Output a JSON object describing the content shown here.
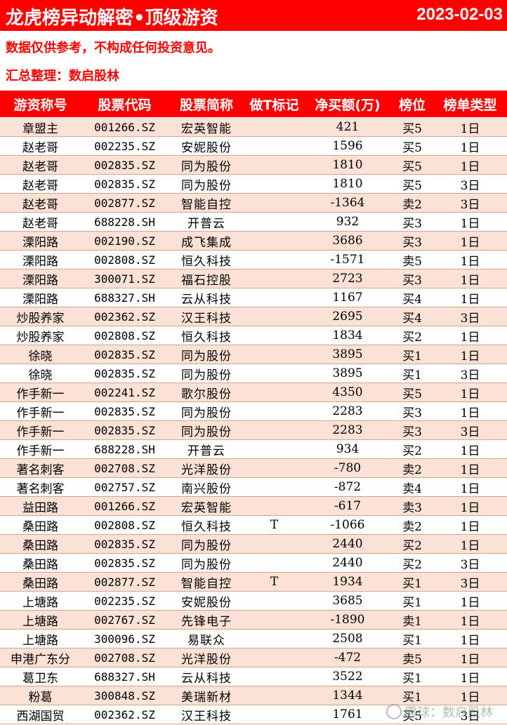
{
  "header": {
    "title": "龙虎榜异动解密•顶级游资",
    "date": "2023-02-03",
    "background_color": "#ff0000"
  },
  "disclaimer": "数据仅供参考，不构成任何投资意见。",
  "compiler": "汇总整理：数启股林",
  "table": {
    "columns": [
      "游资称号",
      "股票代码",
      "股票简称",
      "做T标记",
      "净买额(万)",
      "榜位",
      "榜单类型"
    ],
    "rows": [
      {
        "trader": "章盟主",
        "code": "001266.SZ",
        "name": "宏英智能",
        "t": "",
        "amount": "421",
        "rank": "买5",
        "type": "1日"
      },
      {
        "trader": "赵老哥",
        "code": "002235.SZ",
        "name": "安妮股份",
        "t": "",
        "amount": "1596",
        "rank": "买5",
        "type": "1日"
      },
      {
        "trader": "赵老哥",
        "code": "002835.SZ",
        "name": "同为股份",
        "t": "",
        "amount": "1810",
        "rank": "买5",
        "type": "1日"
      },
      {
        "trader": "赵老哥",
        "code": "002835.SZ",
        "name": "同为股份",
        "t": "",
        "amount": "1810",
        "rank": "买5",
        "type": "3日"
      },
      {
        "trader": "赵老哥",
        "code": "002877.SZ",
        "name": "智能自控",
        "t": "",
        "amount": "-1364",
        "rank": "卖2",
        "type": "3日"
      },
      {
        "trader": "赵老哥",
        "code": "688228.SH",
        "name": "开普云",
        "t": "",
        "amount": "932",
        "rank": "买3",
        "type": "1日"
      },
      {
        "trader": "溧阳路",
        "code": "002190.SZ",
        "name": "成飞集成",
        "t": "",
        "amount": "3686",
        "rank": "买3",
        "type": "1日"
      },
      {
        "trader": "溧阳路",
        "code": "002808.SZ",
        "name": "恒久科技",
        "t": "",
        "amount": "-1571",
        "rank": "卖5",
        "type": "1日"
      },
      {
        "trader": "溧阳路",
        "code": "300071.SZ",
        "name": "福石控股",
        "t": "",
        "amount": "2723",
        "rank": "买3",
        "type": "1日"
      },
      {
        "trader": "溧阳路",
        "code": "688327.SH",
        "name": "云从科技",
        "t": "",
        "amount": "1167",
        "rank": "买4",
        "type": "1日"
      },
      {
        "trader": "炒股养家",
        "code": "002362.SZ",
        "name": "汉王科技",
        "t": "",
        "amount": "2695",
        "rank": "买4",
        "type": "3日"
      },
      {
        "trader": "炒股养家",
        "code": "002808.SZ",
        "name": "恒久科技",
        "t": "",
        "amount": "1834",
        "rank": "买2",
        "type": "1日"
      },
      {
        "trader": "徐晓",
        "code": "002835.SZ",
        "name": "同为股份",
        "t": "",
        "amount": "3895",
        "rank": "买1",
        "type": "1日"
      },
      {
        "trader": "徐晓",
        "code": "002835.SZ",
        "name": "同为股份",
        "t": "",
        "amount": "3895",
        "rank": "买1",
        "type": "3日"
      },
      {
        "trader": "作手新一",
        "code": "002241.SZ",
        "name": "歌尔股份",
        "t": "",
        "amount": "4350",
        "rank": "买5",
        "type": "1日"
      },
      {
        "trader": "作手新一",
        "code": "002835.SZ",
        "name": "同为股份",
        "t": "",
        "amount": "2283",
        "rank": "买3",
        "type": "1日"
      },
      {
        "trader": "作手新一",
        "code": "002835.SZ",
        "name": "同为股份",
        "t": "",
        "amount": "2283",
        "rank": "买3",
        "type": "3日"
      },
      {
        "trader": "作手新一",
        "code": "688228.SH",
        "name": "开普云",
        "t": "",
        "amount": "934",
        "rank": "买2",
        "type": "1日"
      },
      {
        "trader": "著名刺客",
        "code": "002708.SZ",
        "name": "光洋股份",
        "t": "",
        "amount": "-780",
        "rank": "卖2",
        "type": "1日"
      },
      {
        "trader": "著名刺客",
        "code": "002757.SZ",
        "name": "南兴股份",
        "t": "",
        "amount": "-872",
        "rank": "卖4",
        "type": "1日"
      },
      {
        "trader": "益田路",
        "code": "001266.SZ",
        "name": "宏英智能",
        "t": "",
        "amount": "-617",
        "rank": "卖3",
        "type": "1日"
      },
      {
        "trader": "桑田路",
        "code": "002808.SZ",
        "name": "恒久科技",
        "t": "T",
        "amount": "-1066",
        "rank": "卖2",
        "type": "1日"
      },
      {
        "trader": "桑田路",
        "code": "002835.SZ",
        "name": "同为股份",
        "t": "",
        "amount": "2440",
        "rank": "买2",
        "type": "1日"
      },
      {
        "trader": "桑田路",
        "code": "002835.SZ",
        "name": "同为股份",
        "t": "",
        "amount": "2440",
        "rank": "买2",
        "type": "3日"
      },
      {
        "trader": "桑田路",
        "code": "002877.SZ",
        "name": "智能自控",
        "t": "T",
        "amount": "1934",
        "rank": "买1",
        "type": "3日"
      },
      {
        "trader": "上塘路",
        "code": "002235.SZ",
        "name": "安妮股份",
        "t": "",
        "amount": "3685",
        "rank": "买1",
        "type": "1日"
      },
      {
        "trader": "上塘路",
        "code": "002767.SZ",
        "name": "先锋电子",
        "t": "",
        "amount": "-1890",
        "rank": "卖1",
        "type": "1日"
      },
      {
        "trader": "上塘路",
        "code": "300096.SZ",
        "name": "易联众",
        "t": "",
        "amount": "2508",
        "rank": "买1",
        "type": "1日"
      },
      {
        "trader": "申港广东分",
        "code": "002708.SZ",
        "name": "光洋股份",
        "t": "",
        "amount": "-472",
        "rank": "卖5",
        "type": "1日"
      },
      {
        "trader": "葛卫东",
        "code": "688327.SH",
        "name": "云从科技",
        "t": "",
        "amount": "3522",
        "rank": "买1",
        "type": "1日"
      },
      {
        "trader": "粉葛",
        "code": "300848.SZ",
        "name": "美瑞新材",
        "t": "",
        "amount": "1344",
        "rank": "买1",
        "type": "1日"
      },
      {
        "trader": "西湖国贸",
        "code": "002362.SZ",
        "name": "汉王科技",
        "t": "",
        "amount": "1761",
        "rank": "买5",
        "type": "3日"
      }
    ]
  },
  "watermark": "雪球：数启股林"
}
